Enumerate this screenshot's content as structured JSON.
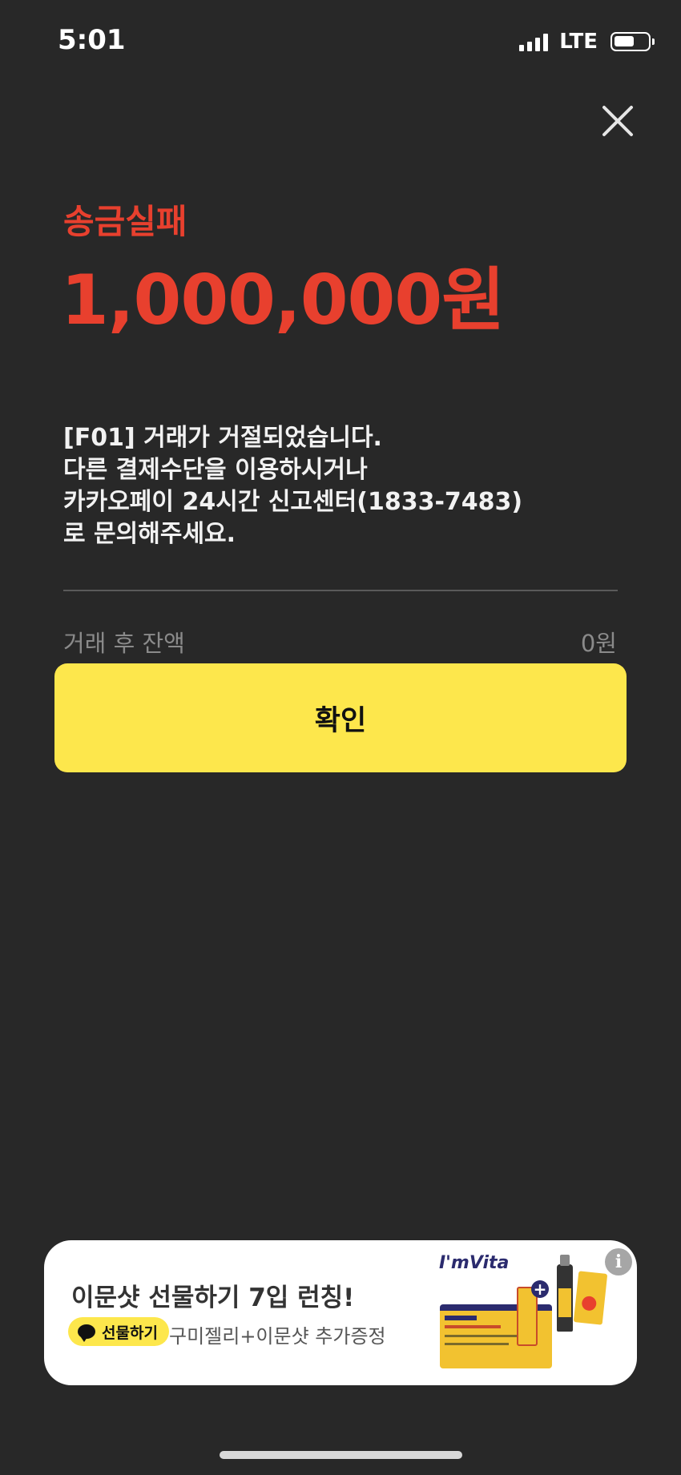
{
  "status_bar": {
    "time": "5:01",
    "network": "LTE",
    "signal_bars": 4,
    "battery_level": 0.6
  },
  "close_icon": "close-icon",
  "result": {
    "title": "송금실패",
    "amount": "1,000,000원",
    "accent_color": "#e8402e"
  },
  "message": {
    "lines": [
      "[F01] 거래가 거절되었습니다.",
      "다른 결제수단을 이용하시거나",
      "카카오페이 24시간 신고센터(1833-7483)",
      "로 문의해주세요."
    ]
  },
  "balance": {
    "label": "거래 후 잔액",
    "value": "0원"
  },
  "confirm_button": {
    "label": "확인",
    "color": "#fde74c"
  },
  "ad": {
    "headline": "이문샷 선물하기 7입 런칭!",
    "pill_label": "선물하기",
    "subtext": "구미젤리+이문샷 추가증정",
    "brand": "I'mVita",
    "info_icon": "info-icon"
  }
}
